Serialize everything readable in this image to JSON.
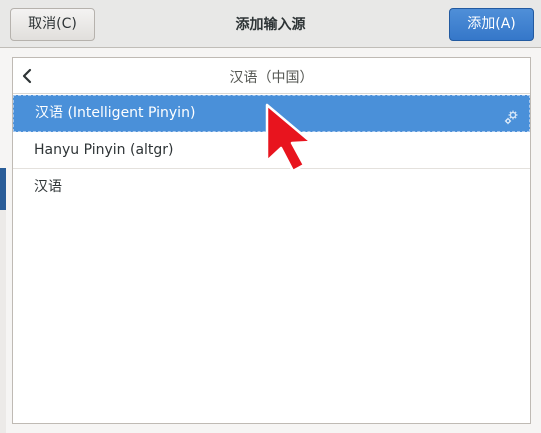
{
  "dialog": {
    "title": "添加输入源",
    "cancel_label": "取消(C)",
    "add_label": "添加(A)"
  },
  "list": {
    "header_title": "汉语（中国）",
    "items": [
      {
        "label": "汉语 (Intelligent Pinyin)",
        "selected": true,
        "has_settings": true
      },
      {
        "label": "Hanyu Pinyin (altgr)",
        "selected": false
      },
      {
        "label": "汉语",
        "selected": false
      }
    ]
  },
  "colors": {
    "accent": "#4a90d9",
    "add_button": "#3a7ccc",
    "cursor": "#e8141e"
  },
  "icons": {
    "back": "chevron-left-icon",
    "settings": "gear-icon",
    "pointer": "mouse-pointer-icon"
  }
}
